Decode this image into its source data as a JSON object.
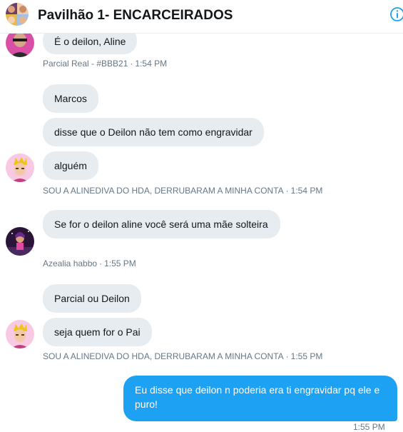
{
  "header": {
    "title": "Pavilhão 1- ENCARCEIRADOS",
    "info_icon": "info-icon"
  },
  "messages": [
    {
      "text": "É o deilon, Aline"
    },
    {
      "text": "Marcos"
    },
    {
      "text": "disse que o Deilon não tem como engravidar"
    },
    {
      "text": "alguém"
    },
    {
      "text": "Se for o deilon aline você será uma mãe solteira"
    },
    {
      "text": "Parcial ou Deilon"
    },
    {
      "text": "seja quem for o Pai"
    },
    {
      "text": "Eu disse que deilon n poderia era ti engravidar pq ele e puro!"
    }
  ],
  "meta": [
    {
      "sender": "Parcial Real - #BBB21",
      "separator": "·",
      "time": "1:54 PM"
    },
    {
      "sender": "SOU A ALINEDIVA DO HDA, DERRUBARAM A MINHA CONTA",
      "separator": "·",
      "time": "1:54 PM"
    },
    {
      "sender": "Azealia habbo",
      "separator": "·",
      "time": "1:55 PM"
    },
    {
      "sender": "SOU A ALINEDIVA DO HDA, DERRUBARAM A MINHA CONTA",
      "separator": "·",
      "time": "1:55 PM"
    }
  ],
  "outgoing_meta": {
    "time": "1:55 PM"
  },
  "colors": {
    "incoming_bubble": "#e6ecf0",
    "outgoing_bubble": "#1da1f2",
    "accent": "#1da1f2",
    "meta_text": "#657786"
  }
}
